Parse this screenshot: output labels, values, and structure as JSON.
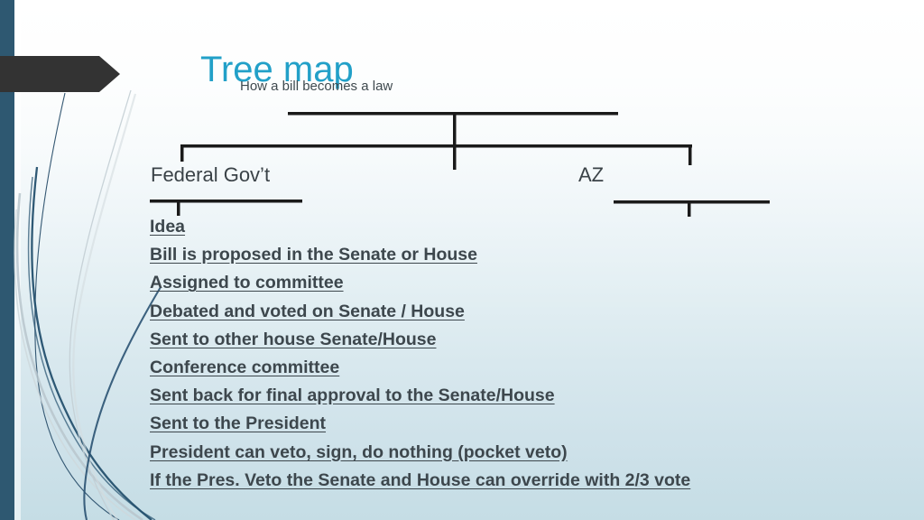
{
  "slide": {
    "title": "Tree map",
    "subtitle": "How a bill becomes a law",
    "title_color": "#22a0c8",
    "accent_stripe_color": "#2e5871",
    "banner_color": "#333333",
    "text_color": "#3d474d",
    "background_top_color": "#ffffff",
    "background_bottom_color": "#c5dde5"
  },
  "tree": {
    "nodes": [
      {
        "label": "Federal Gov’t"
      },
      {
        "label": "AZ"
      }
    ]
  },
  "list": {
    "items": [
      "Idea",
      "Bill is proposed in the Senate or House",
      "Assigned to committee",
      "Debated and voted on Senate / House",
      "Sent to other house Senate/House",
      "Conference committee",
      "Sent back for final approval to the Senate/House",
      "Sent to the President",
      "President can veto, sign, do nothing (pocket veto)",
      "If the Pres. Veto the Senate and  House can override with 2/3 vote"
    ]
  }
}
